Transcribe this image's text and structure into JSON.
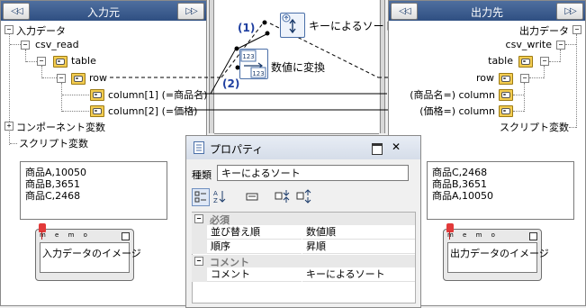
{
  "input_panel": {
    "title": "入力元",
    "prev_btn": "◁◁",
    "next_btn": "▷▷",
    "tree": {
      "root": "入力データ",
      "csv_read": "csv_read",
      "table": "table",
      "row": "row",
      "col1": "column[1] (=商品名)",
      "col2": "column[2] (=価格)",
      "components": "コンポーネント変数",
      "scripts": "スクリプト変数"
    },
    "data_lines": [
      "商品A,10050",
      "商品B,3651",
      "商品C,2468"
    ],
    "memo_label": "m e m o",
    "memo_text": "入力データのイメージ"
  },
  "output_panel": {
    "title": "出力先",
    "prev_btn": "◁◁",
    "next_btn": "▷▷",
    "tree": {
      "root": "出力データ",
      "csv_write": "csv_write",
      "table": "table",
      "row": "row",
      "col1": "(商品名=) column",
      "col2": "(価格=) column",
      "scripts": "スクリプト変数"
    },
    "data_lines": [
      "商品C,2468",
      "商品B,3651",
      "商品A,10050"
    ],
    "memo_label": "m e m o",
    "memo_text": "出力データのイメージ"
  },
  "mapping": {
    "sort_label": "キーによるソート",
    "convert_label": "数値に変換",
    "marker1": "(1)",
    "marker2": "(2)",
    "icon_text": "123"
  },
  "properties": {
    "title": "プロパティ",
    "kind_label": "種類",
    "kind_value": "キーによるソート",
    "required_category": "必須",
    "rows": [
      {
        "label": "並び替え順",
        "value": "数値順"
      },
      {
        "label": "順序",
        "value": "昇順"
      }
    ],
    "comment_category": "コメント",
    "comment_row": {
      "label": "コメント",
      "value": "キーによるソート"
    },
    "close_glyph": "✕",
    "collapse_glyph": "−"
  },
  "colors": {
    "header_bg": "#2f4f82",
    "link_blue": "#1f3fa0",
    "memo_pin": "#e23a3a"
  }
}
